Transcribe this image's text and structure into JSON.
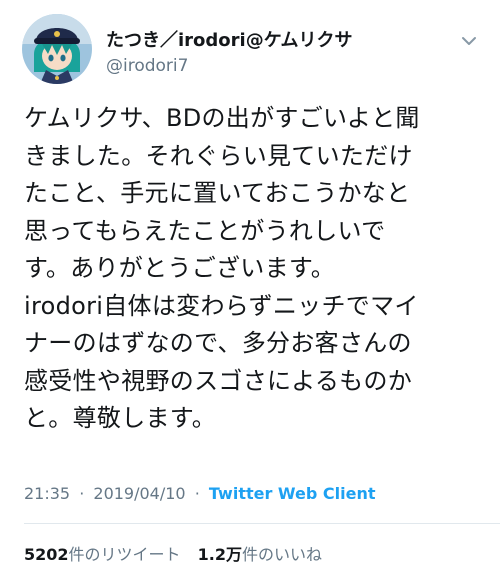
{
  "tweet": {
    "user": {
      "display_name": "たつき／irodori@ケムリクサ",
      "handle": "@irodori7",
      "avatar_icon": "avatar-image"
    },
    "menu_icon": "chevron-down-icon",
    "text": "ケムリクサ、BDの出がすごいよと聞\nきました。それぐらい見ていただけ\nたこと、手元に置いておこうかなと\n思ってもらえたことがうれしいで\nす。ありがとうございます。\nirodori自体は変わらずニッチでマイ\nナーのはずなので、多分お客さんの\n感受性や視野のスゴさによるものか\nと。尊敬します。",
    "time": "21:35",
    "separator": "·",
    "date": "2019/04/10",
    "client": "Twitter Web Client",
    "retweets": {
      "count": "5202",
      "label": "件のリツイート"
    },
    "likes": {
      "count": "1.2万",
      "label": "件のいいね"
    }
  },
  "colors": {
    "accent": "#1da1f2",
    "secondary_text": "#657786",
    "primary_text": "#14171a",
    "divider": "#e1e8ed"
  }
}
